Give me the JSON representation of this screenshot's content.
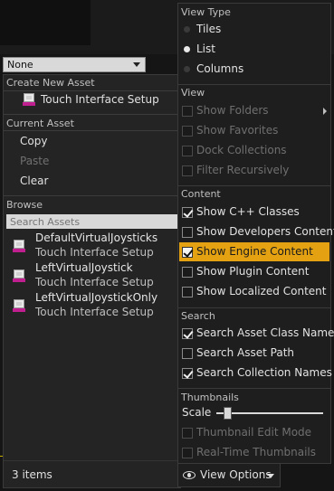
{
  "none_dropdown": {
    "value": "None"
  },
  "picker": {
    "create_header": "Create New Asset",
    "create_item": "Touch Interface Setup",
    "current_header": "Current Asset",
    "copy": "Copy",
    "paste": "Paste",
    "clear": "Clear",
    "browse_header": "Browse",
    "search_placeholder": "Search Assets",
    "assets": [
      {
        "name": "DefaultVirtualJoysticks",
        "type": "Touch Interface Setup"
      },
      {
        "name": "LeftVirtualJoystick",
        "type": "Touch Interface Setup"
      },
      {
        "name": "LeftVirtualJoystickOnly",
        "type": "Touch Interface Setup"
      }
    ],
    "item_count": "3 items"
  },
  "view_options": {
    "label": "View Options"
  },
  "menu": {
    "view_type": {
      "header": "View Type",
      "items": [
        {
          "label": "Tiles",
          "selected": false
        },
        {
          "label": "List",
          "selected": true
        },
        {
          "label": "Columns",
          "selected": false
        }
      ]
    },
    "view": {
      "header": "View",
      "items": [
        {
          "label": "Show Folders",
          "checked": false,
          "disabled": true
        },
        {
          "label": "Show Favorites",
          "checked": false,
          "disabled": true
        },
        {
          "label": "Dock Collections",
          "checked": false,
          "disabled": true
        },
        {
          "label": "Filter Recursively",
          "checked": false,
          "disabled": true
        }
      ]
    },
    "content": {
      "header": "Content",
      "items": [
        {
          "label": "Show C++ Classes",
          "checked": true
        },
        {
          "label": "Show Developers Content",
          "checked": false
        },
        {
          "label": "Show Engine Content",
          "checked": true,
          "highlighted": true
        },
        {
          "label": "Show Plugin Content",
          "checked": false
        },
        {
          "label": "Show Localized Content",
          "checked": false
        }
      ]
    },
    "search": {
      "header": "Search",
      "items": [
        {
          "label": "Search Asset Class Names",
          "checked": true
        },
        {
          "label": "Search Asset Path",
          "checked": false
        },
        {
          "label": "Search Collection Names",
          "checked": true
        }
      ]
    },
    "thumbnails": {
      "header": "Thumbnails",
      "scale_label": "Scale",
      "scale_value": 0.1,
      "items": [
        {
          "label": "Thumbnail Edit Mode",
          "checked": false,
          "disabled": true
        },
        {
          "label": "Real-Time Thumbnails",
          "checked": false,
          "disabled": true
        }
      ]
    }
  },
  "colors": {
    "highlight": "#e4a213",
    "asset_type_accent": "#c0208f"
  }
}
